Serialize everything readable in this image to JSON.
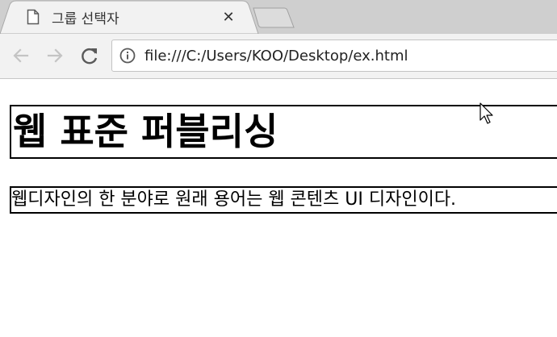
{
  "browser": {
    "tab": {
      "title": "그룹 선택자",
      "page_icon": "page-icon",
      "close_icon": "close-icon",
      "close_symbol": "✕"
    },
    "new_tab_icon": "new-tab-icon",
    "toolbar": {
      "back_icon": "back-arrow-icon",
      "forward_icon": "forward-arrow-icon",
      "reload_icon": "reload-icon",
      "info_icon": "info-icon",
      "url": "file:///C:/Users/KOO/Desktop/ex.html"
    },
    "colors": {
      "tabstrip": "#cfcfcf",
      "active_tab": "#f2f2f2",
      "toolbar": "#f2f2f2",
      "disabled_icon": "#c4c4c4",
      "icon": "#5a5a5a"
    }
  },
  "page": {
    "heading": "웹 표준 퍼블리싱",
    "paragraph": "웹디자인의 한 분야로 원래 용어는 웹 콘텐츠 UI 디자인이다."
  },
  "cursor_icon": "mouse-cursor-icon"
}
